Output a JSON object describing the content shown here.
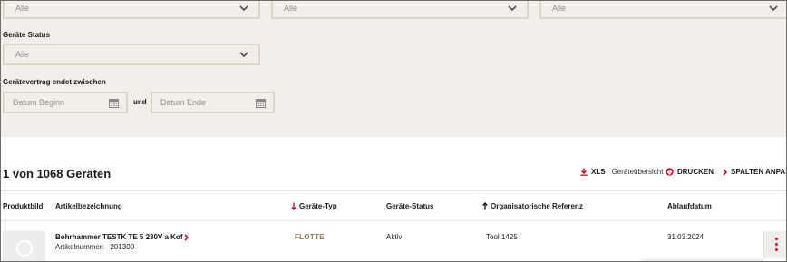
{
  "filters": {
    "top_selects": [
      "Alle",
      "Alle",
      "Alle"
    ],
    "status_label": "Geräte Status",
    "status_value": "Alle",
    "contract_label": "Gerätevertrag endet zwischen",
    "date_start_placeholder": "Datum Beginn",
    "date_connector": "und",
    "date_end_placeholder": "Datum Ende"
  },
  "results": {
    "count_text": "1 von 1068 Geräten",
    "xls_label": "XLS",
    "xls_sub": "Geräteübersicht",
    "print_label": "DRUCKEN",
    "columns_label": "SPALTEN ANPASS"
  },
  "table": {
    "headers": [
      "Produktbild",
      "Artikelbezeichnung",
      "Geräte-Typ",
      "Geräte-Status",
      "Organisatorische Referenz",
      "Ablaufdatum"
    ],
    "rows": [
      {
        "name": "Bohrhammer TESTK TE 5 230V a Kof",
        "article_label": "Artikelnummer:",
        "article_number": "201300",
        "type": "FLOTTE",
        "status": "Aktiv",
        "reference": "Tool 1425",
        "expiry": "31.03.2024"
      }
    ]
  },
  "colors": {
    "accent": "#c8102e",
    "filter_bg": "#f2efea",
    "border": "#ddd5c8",
    "flotte": "#8a7a5a"
  }
}
